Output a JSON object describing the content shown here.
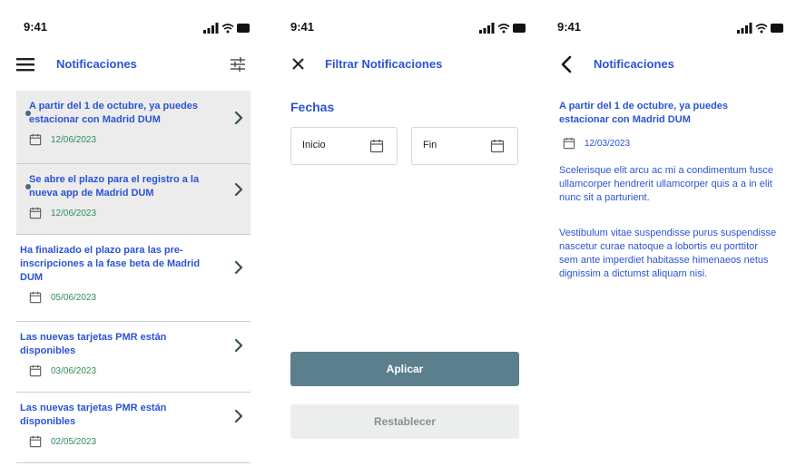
{
  "status": {
    "time": "9:41"
  },
  "list_screen": {
    "title": "Notificaciones",
    "menu_icon": "hamburger-menu-icon",
    "filter_icon": "filter-sliders-icon",
    "items": [
      {
        "title": "A partir del 1 de octubre, ya puedes estacionar con Madrid DUM",
        "date": "12/06/2023",
        "unread": true
      },
      {
        "title": "Se abre el plazo para el registro a la nueva app de Madrid DUM",
        "date": "12/06/2023",
        "unread": true
      },
      {
        "title": "Ha finalizado el plazo para las pre-inscripciones a la fase beta de Madrid DUM",
        "date": "05/06/2023",
        "unread": false
      },
      {
        "title": "Las nuevas tarjetas PMR están disponibles",
        "date": "03/06/2023",
        "unread": false
      },
      {
        "title": "Las nuevas tarjetas PMR están disponibles",
        "date": "02/05/2023",
        "unread": false
      }
    ]
  },
  "filter_screen": {
    "title": "Filtrar Notificaciones",
    "close_icon": "close-icon",
    "section_title": "Fechas",
    "start_label": "Inicio",
    "end_label": "Fin",
    "apply_label": "Aplicar",
    "reset_label": "Restablecer"
  },
  "detail_screen": {
    "title": "Notificaciones",
    "back_icon": "chevron-left-icon",
    "notification_title": "A partir del 1 de octubre, ya puedes estacionar con Madrid DUM",
    "date": "12/03/2023",
    "paragraph_1": "Scelerisque elit arcu ac mi a condimentum fusce ullamcorper hendrerit ullamcorper quis a a in elit nunc sit a parturient.",
    "paragraph_2": "Vestibulum vitae suspendisse purus suspendisse nascetur curae natoque a lobortis eu porttitor sem ante imperdiet habitasse himenaeos netus dignissim a dictumst aliquam nisi."
  },
  "colors": {
    "accent_blue": "#2b53d6",
    "date_green": "#2e8c5a",
    "primary_button": "#5b7f8c",
    "secondary_button": "#eceeee",
    "unread_bg": "#ececec"
  }
}
